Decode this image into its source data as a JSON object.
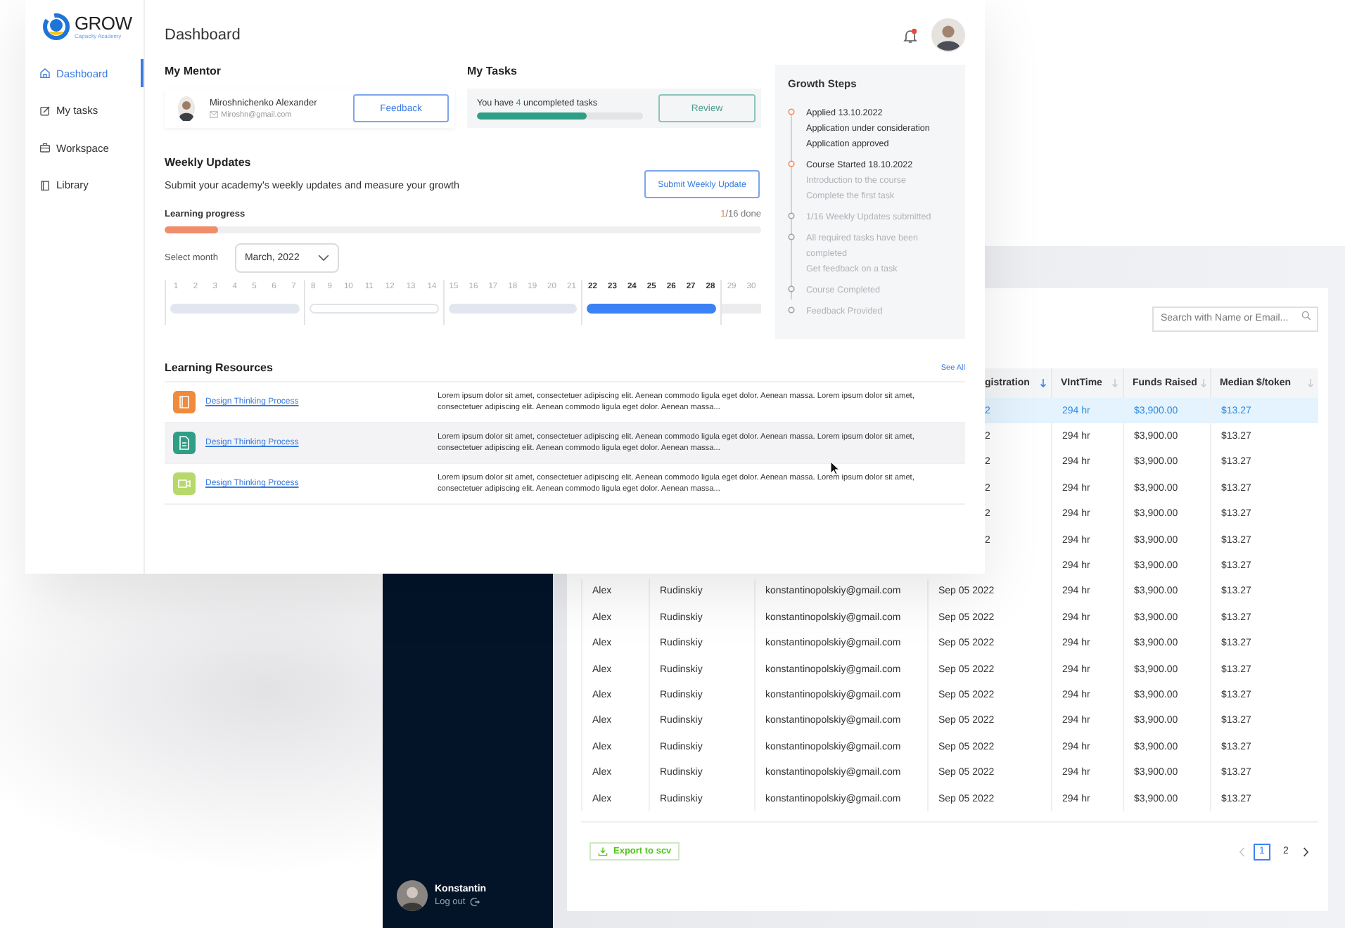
{
  "dashboard": {
    "sidebar": {
      "logo": {
        "name": "GROW",
        "tagline": "Capacity Academy"
      },
      "items": [
        {
          "label": "Dashboard",
          "kind": "home",
          "selected": true
        },
        {
          "label": "My tasks",
          "kind": "tasks",
          "selected": false
        },
        {
          "label": "Workspace",
          "kind": "briefcase",
          "selected": false
        },
        {
          "label": "Library",
          "kind": "book",
          "selected": false
        }
      ]
    },
    "header": {
      "title": "Dashboard",
      "notification": true
    },
    "mentor": {
      "heading": "My Mentor",
      "name": "Miroshnichenko Alexander",
      "email": "Miroshn@gmail.com",
      "button": "Feedback"
    },
    "tasks": {
      "heading": "My Tasks",
      "text_before": "You have",
      "count": "4",
      "text_after": "uncompleted tasks",
      "level": 0.66,
      "button": "Review"
    },
    "weekly_updates": {
      "heading": "Weekly Updates",
      "description": "Submit your academy's weekly updates and measure your growth",
      "button": "Submit Weekly Update"
    },
    "learning_progress": {
      "label": "Learning progress",
      "done": "1",
      "total": "/16 done",
      "level": 0.09
    },
    "month": {
      "label": "Select month",
      "value": "March, 2022"
    },
    "weeks": [
      {
        "days": [
          "1",
          "2",
          "3",
          "4",
          "5",
          "6",
          "7"
        ],
        "kind": "submitted"
      },
      {
        "days": [
          "8",
          "9",
          "10",
          "11",
          "12",
          "13",
          "14"
        ],
        "kind": "missed"
      },
      {
        "days": [
          "15",
          "16",
          "17",
          "18",
          "19",
          "20",
          "21"
        ],
        "kind": "submitted"
      },
      {
        "days": [
          "22",
          "23",
          "24",
          "25",
          "26",
          "27",
          "28"
        ],
        "kind": "current"
      },
      {
        "days": [
          "29",
          "30"
        ],
        "kind": "upcoming"
      }
    ],
    "growth_steps": {
      "title": "Growth Steps",
      "steps": [
        {
          "done": true,
          "lines": [
            {
              "text": "Applied 13.10.2022",
              "done": true
            },
            {
              "text": "Application under consideration",
              "done": true
            },
            {
              "text": "Application approved",
              "done": true
            }
          ]
        },
        {
          "done": true,
          "lines": [
            {
              "text": "Course Started 18.10.2022",
              "done": true
            },
            {
              "text": "Introduction to the course",
              "done": false
            },
            {
              "text": "Complete the first task",
              "done": false
            }
          ]
        },
        {
          "done": false,
          "lines": [
            {
              "text": "1/16 Weekly Updates submitted",
              "done": false
            }
          ]
        },
        {
          "done": false,
          "lines": [
            {
              "text": "All required tasks have been completed",
              "done": false
            },
            {
              "text": "Get feedback on a task",
              "done": false
            }
          ]
        },
        {
          "done": false,
          "lines": [
            {
              "text": "Course Completed",
              "done": false
            }
          ]
        },
        {
          "done": false,
          "lines": [
            {
              "text": "Feedback Provided",
              "done": false
            }
          ]
        }
      ]
    },
    "resources": {
      "title": "Learning Resources",
      "see_all": "See All",
      "items": [
        {
          "kind": "book",
          "color": "#f08a3c",
          "title": "Design Thinking Process",
          "description": "Lorem ipsum dolor sit amet, consectetuer adipiscing elit. Aenean commodo ligula eget dolor. Aenean massa. Lorem ipsum dolor sit amet, consectetuer adipiscing elit. Aenean commodo ligula eget dolor. Aenean massa...",
          "selected": false
        },
        {
          "kind": "document",
          "color": "#2e9e86",
          "title": "Design Thinking Process",
          "description": "Lorem ipsum dolor sit amet, consectetuer adipiscing elit. Aenean commodo ligula eget dolor. Aenean massa. Lorem ipsum dolor sit amet, consectetuer adipiscing elit. Aenean commodo ligula eget dolor. Aenean massa...",
          "selected": true
        },
        {
          "kind": "video",
          "color": "#b7d86a",
          "title": "Design Thinking Process",
          "description": "Lorem ipsum dolor sit amet, consectetuer adipiscing elit. Aenean commodo ligula eget dolor. Aenean massa. Lorem ipsum dolor sit amet, consectetuer adipiscing elit. Aenean commodo ligula eget dolor. Aenean massa...",
          "selected": false
        }
      ]
    }
  },
  "admin": {
    "user": {
      "name": "Konstantin",
      "logout": "Log out"
    },
    "search": {
      "placeholder": "Search with Name or Email..."
    },
    "headers": [
      {
        "label": "gistration",
        "sorted": true
      },
      {
        "label": "VIntTime",
        "sorted": false
      },
      {
        "label": "Funds Raised",
        "sorted": false
      },
      {
        "label": "Median $/token",
        "sorted": false
      }
    ],
    "rows": [
      {
        "cells": [
          "2",
          "294 hr",
          "$3,900.00",
          "$13.27"
        ],
        "selected": true
      },
      {
        "cells": [
          "2",
          "294 hr",
          "$3,900.00",
          "$13.27"
        ],
        "selected": false
      },
      {
        "cells": [
          "2",
          "294 hr",
          "$3,900.00",
          "$13.27"
        ],
        "selected": false
      },
      {
        "cells": [
          "2",
          "294 hr",
          "$3,900.00",
          "$13.27"
        ],
        "selected": false
      },
      {
        "cells": [
          "2",
          "294 hr",
          "$3,900.00",
          "$13.27"
        ],
        "selected": false
      },
      {
        "cells": [
          "2",
          "294 hr",
          "$3,900.00",
          "$13.27"
        ],
        "selected": false
      },
      {
        "cells": [
          "",
          "294 hr",
          "$3,900.00",
          "$13.27"
        ],
        "selected": false
      },
      {
        "cells": [
          "Alex",
          "Rudinskiy",
          "konstantinopolskiy@gmail.com",
          "Sep 05 2022",
          "294 hr",
          "$3,900.00",
          "$13.27"
        ],
        "selected": false
      },
      {
        "cells": [
          "Alex",
          "Rudinskiy",
          "konstantinopolskiy@gmail.com",
          "Sep 05 2022",
          "294 hr",
          "$3,900.00",
          "$13.27"
        ],
        "selected": false
      },
      {
        "cells": [
          "Alex",
          "Rudinskiy",
          "konstantinopolskiy@gmail.com",
          "Sep 05 2022",
          "294 hr",
          "$3,900.00",
          "$13.27"
        ],
        "selected": false
      },
      {
        "cells": [
          "Alex",
          "Rudinskiy",
          "konstantinopolskiy@gmail.com",
          "Sep 05 2022",
          "294 hr",
          "$3,900.00",
          "$13.27"
        ],
        "selected": false
      },
      {
        "cells": [
          "Alex",
          "Rudinskiy",
          "konstantinopolskiy@gmail.com",
          "Sep 05 2022",
          "294 hr",
          "$3,900.00",
          "$13.27"
        ],
        "selected": false
      },
      {
        "cells": [
          "Alex",
          "Rudinskiy",
          "konstantinopolskiy@gmail.com",
          "Sep 05 2022",
          "294 hr",
          "$3,900.00",
          "$13.27"
        ],
        "selected": false
      },
      {
        "cells": [
          "Alex",
          "Rudinskiy",
          "konstantinopolskiy@gmail.com",
          "Sep 05 2022",
          "294 hr",
          "$3,900.00",
          "$13.27"
        ],
        "selected": false
      },
      {
        "cells": [
          "Alex",
          "Rudinskiy",
          "konstantinopolskiy@gmail.com",
          "Sep 05 2022",
          "294 hr",
          "$3,900.00",
          "$13.27"
        ],
        "selected": false
      },
      {
        "cells": [
          "Alex",
          "Rudinskiy",
          "konstantinopolskiy@gmail.com",
          "Sep 05 2022",
          "294 hr",
          "$3,900.00",
          "$13.27"
        ],
        "selected": false
      }
    ],
    "export": "Export to scv",
    "pages": [
      {
        "label": "1",
        "selected": true
      },
      {
        "label": "2",
        "selected": false
      }
    ]
  }
}
